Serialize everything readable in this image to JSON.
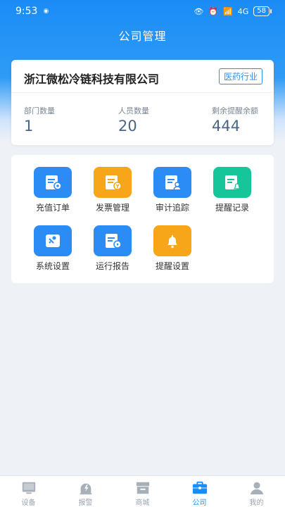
{
  "status_bar": {
    "time": "9:53",
    "signal": "4G",
    "battery": "58"
  },
  "page": {
    "title": "公司管理"
  },
  "company": {
    "name": "浙江微松冷链科技有限公司",
    "industry": "医药行业",
    "stats": [
      {
        "label": "部门数量",
        "value": "1"
      },
      {
        "label": "人员数量",
        "value": "20"
      },
      {
        "label": "剩余提醒余额",
        "value": "444"
      }
    ]
  },
  "functions": [
    {
      "label": "充值订单",
      "icon": "order-icon",
      "color": "#2b8cf5"
    },
    {
      "label": "发票管理",
      "icon": "invoice-icon",
      "color": "#f7a61a"
    },
    {
      "label": "审计追踪",
      "icon": "audit-icon",
      "color": "#2b8cf5"
    },
    {
      "label": "提醒记录",
      "icon": "reminder-record-icon",
      "color": "#16c59a"
    },
    {
      "label": "系统设置",
      "icon": "system-settings-icon",
      "color": "#2b8cf5"
    },
    {
      "label": "运行报告",
      "icon": "report-icon",
      "color": "#2b8cf5"
    },
    {
      "label": "提醒设置",
      "icon": "bell-icon",
      "color": "#f7a61a"
    }
  ],
  "tabbar": {
    "items": [
      {
        "label": "设备",
        "icon": "device-icon",
        "active": false
      },
      {
        "label": "报警",
        "icon": "alarm-icon",
        "active": false
      },
      {
        "label": "商城",
        "icon": "store-icon",
        "active": false
      },
      {
        "label": "公司",
        "icon": "company-icon",
        "active": true
      },
      {
        "label": "我的",
        "icon": "profile-icon",
        "active": false
      }
    ]
  }
}
